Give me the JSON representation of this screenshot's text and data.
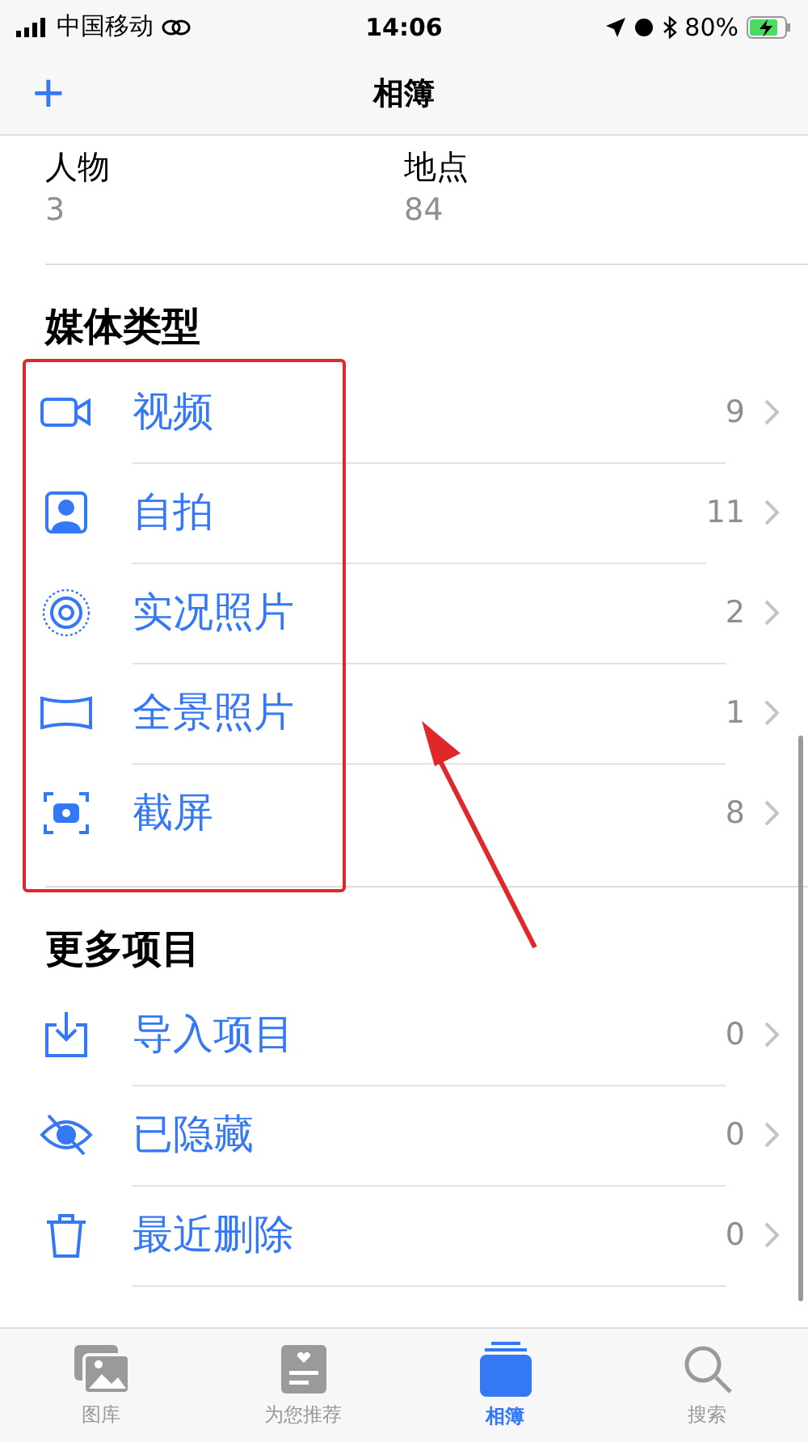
{
  "status_bar": {
    "carrier": "中国移动",
    "time": "14:06",
    "battery": "80%"
  },
  "nav": {
    "add": "+",
    "title": "相簿"
  },
  "people_places": [
    {
      "label": "人物",
      "count": "3"
    },
    {
      "label": "地点",
      "count": "84"
    }
  ],
  "sections": [
    {
      "title": "媒体类型",
      "highlighted": true,
      "items": [
        {
          "kind": "video",
          "label": "视频",
          "count": "9"
        },
        {
          "kind": "selfie",
          "label": "自拍",
          "count": "11"
        },
        {
          "kind": "live",
          "label": "实况照片",
          "count": "2"
        },
        {
          "kind": "panorama",
          "label": "全景照片",
          "count": "1"
        },
        {
          "kind": "screenshot",
          "label": "截屏",
          "count": "8"
        }
      ]
    },
    {
      "title": "更多项目",
      "highlighted": false,
      "items": [
        {
          "kind": "import",
          "label": "导入项目",
          "count": "0"
        },
        {
          "kind": "hidden",
          "label": "已隐藏",
          "count": "0"
        },
        {
          "kind": "deleted",
          "label": "最近删除",
          "count": "0"
        }
      ]
    }
  ],
  "tabs": [
    {
      "kind": "library",
      "label": "图库",
      "selected": false
    },
    {
      "kind": "foryou",
      "label": "为您推荐",
      "selected": false
    },
    {
      "kind": "albums",
      "label": "相簿",
      "selected": true
    },
    {
      "kind": "search",
      "label": "搜索",
      "selected": false
    }
  ]
}
